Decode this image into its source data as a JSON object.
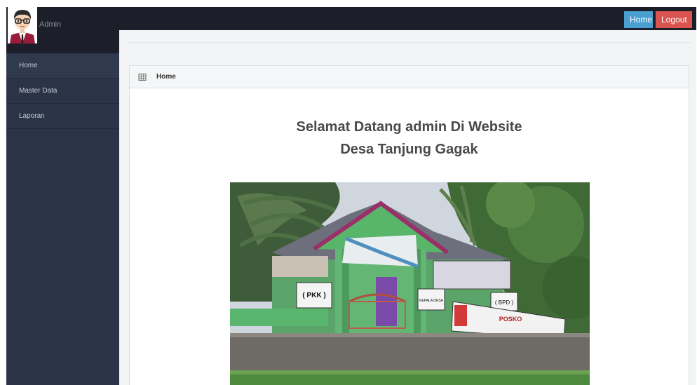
{
  "header": {
    "admin_label": "Admin",
    "home_button": "Home",
    "logout_button": "Logout"
  },
  "sidebar": {
    "items": [
      {
        "label": "Home"
      },
      {
        "label": "Master Data"
      },
      {
        "label": "Laporan"
      }
    ]
  },
  "breadcrumb": {
    "title": "Home"
  },
  "main": {
    "welcome_line1": "Selamat Datang admin Di Website",
    "welcome_line2": "Desa Tanjung Gagak"
  },
  "photo": {
    "signs": {
      "pkk": "( PKK )",
      "bpd": "( BPD )",
      "kepala_desa": "KEPALA DESA",
      "posko": "POSKO"
    }
  },
  "colors": {
    "topbar": "#1c1f2a",
    "sidebar": "#2b3446",
    "home_button": "#4a9fd0",
    "logout_button": "#d9534f"
  }
}
